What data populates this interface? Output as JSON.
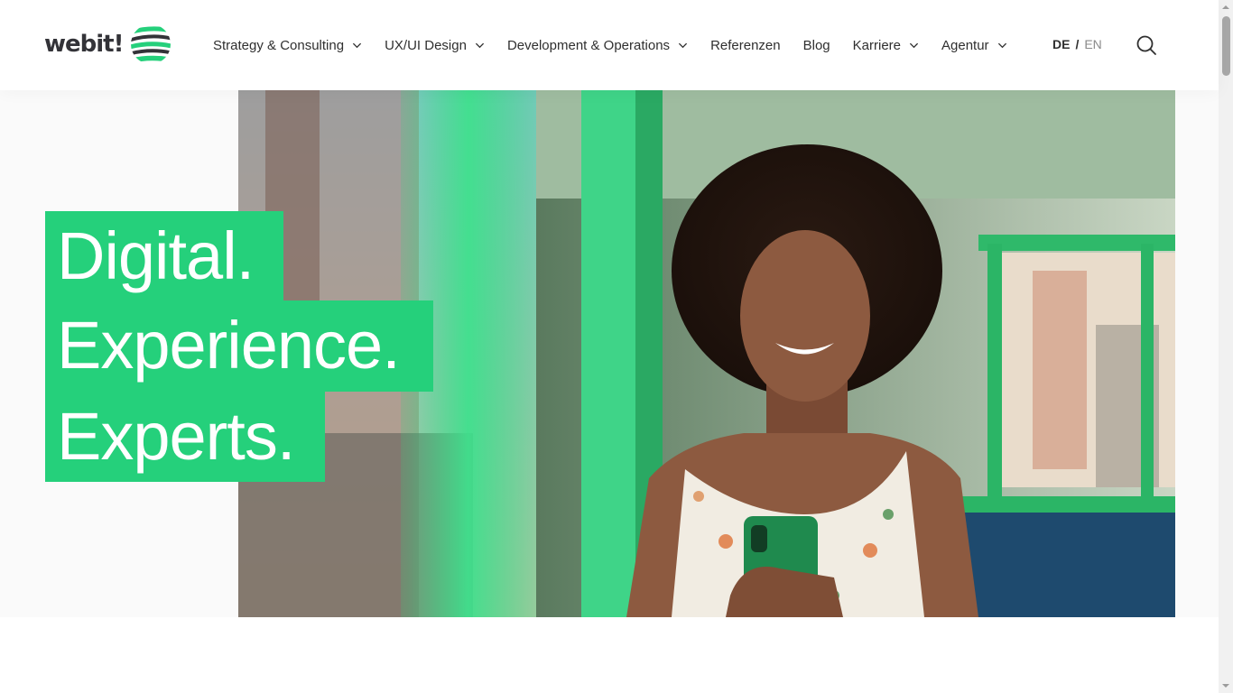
{
  "brand": {
    "name": "webit!",
    "accent": "#25d07b",
    "logo_icon": "striped-globe-icon"
  },
  "nav": {
    "items": [
      {
        "label": "Strategy & Consulting",
        "dropdown": true
      },
      {
        "label": "UX/UI Design",
        "dropdown": true
      },
      {
        "label": "Development & Operations",
        "dropdown": true
      },
      {
        "label": "Referenzen",
        "dropdown": false
      },
      {
        "label": "Blog",
        "dropdown": false
      },
      {
        "label": "Karriere",
        "dropdown": true
      },
      {
        "label": "Agentur",
        "dropdown": true
      }
    ]
  },
  "language": {
    "active": "DE",
    "separator": "/",
    "other": "EN"
  },
  "search": {
    "icon": "search-icon"
  },
  "hero": {
    "headline": [
      "Digital.",
      "Experience.",
      "Experts."
    ],
    "image_icon": "hero-photo-woman-with-smartphone-in-green-tram"
  }
}
